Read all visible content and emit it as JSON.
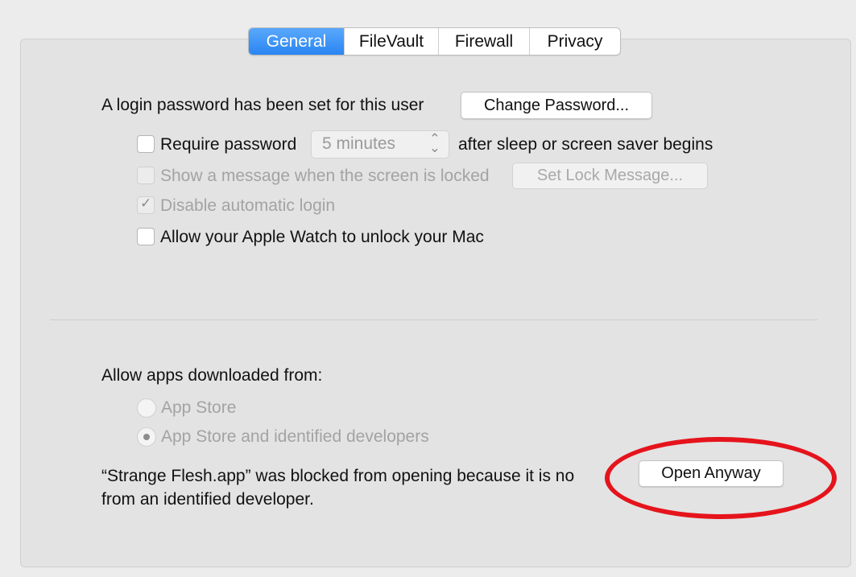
{
  "tabs": [
    {
      "label": "General",
      "active": true
    },
    {
      "label": "FileVault",
      "active": false
    },
    {
      "label": "Firewall",
      "active": false
    },
    {
      "label": "Privacy",
      "active": false
    }
  ],
  "login": {
    "text": "A login password has been set for this user",
    "change_password_button": "Change Password..."
  },
  "options": {
    "require_password": {
      "label": "Require password",
      "checked": false
    },
    "require_password_select": {
      "value": "5 minutes"
    },
    "require_password_suffix": "after sleep or screen saver begins",
    "show_message": {
      "label": "Show a message when the screen is locked",
      "checked": false,
      "disabled": true
    },
    "set_lock_message_button": "Set Lock Message...",
    "disable_auto_login": {
      "label": "Disable automatic login",
      "checked": true,
      "disabled": true
    },
    "apple_watch": {
      "label": "Allow your Apple Watch to unlock your Mac",
      "checked": false
    }
  },
  "gatekeeper": {
    "heading": "Allow apps downloaded from:",
    "radio_app_store": {
      "label": "App Store",
      "selected": false
    },
    "radio_identified": {
      "label": "App Store and identified developers",
      "selected": true
    },
    "blocked_line1": "“Strange Flesh.app” was blocked from opening because it is no",
    "blocked_line2": "from an identified developer.",
    "open_anyway_button": "Open Anyway"
  },
  "highlight_color": "#e5141c",
  "icons": {
    "check": "checkmark-icon",
    "stepper": "up-down-chevron-icon"
  }
}
